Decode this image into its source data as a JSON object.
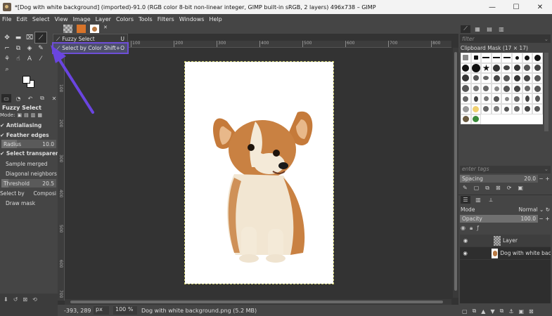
{
  "window": {
    "title": "*[Dog with white background] (imported)-91.0 (RGB color 8-bit non-linear integer, GIMP built-in sRGB, 2 layers) 496x738 – GIMP",
    "controls": [
      "—",
      "☐",
      "✕"
    ]
  },
  "menu": [
    "File",
    "Edit",
    "Select",
    "View",
    "Image",
    "Layer",
    "Colors",
    "Tools",
    "Filters",
    "Windows",
    "Help"
  ],
  "flyout": {
    "items": [
      {
        "label": "Fuzzy Select",
        "shortcut": "U"
      },
      {
        "label": "Select by Color",
        "shortcut": "Shift+O"
      }
    ]
  },
  "tool_options": {
    "title": "Fuzzy Select",
    "mode_label": "Mode:",
    "antialiasing": "Antialiasing",
    "feather": "Feather edges",
    "radius_label": "Radius",
    "radius_value": "10.0",
    "select_transparent": "Select transparent a",
    "sample_merged": "Sample merged",
    "diagonal": "Diagonal neighbors",
    "threshold_label": "Threshold",
    "threshold_value": "20.5",
    "select_by_label": "Select by",
    "select_by_value": "Composi",
    "draw_mask": "Draw mask"
  },
  "ruler": {
    "top_ticks": [
      "100",
      "200",
      "300",
      "400",
      "500",
      "600",
      "700",
      "800"
    ],
    "left_ticks": [
      "100",
      "200",
      "300",
      "400",
      "500",
      "600",
      "700"
    ]
  },
  "statusbar": {
    "coords": "-393, 289",
    "unit": "px",
    "zoom": "100 %",
    "message": "Dog with white background.png (5.2 MB)"
  },
  "right_dock": {
    "filter_placeholder": "filter",
    "brush_title": "Clipboard Mask (17 × 17)",
    "tags_placeholder": "enter tags",
    "spacing_label": "Spacing",
    "spacing_value": "20.0",
    "mode_label": "Mode",
    "mode_value": "Normal",
    "opacity_label": "Opacity",
    "opacity_value": "100.0",
    "layers": [
      {
        "name": "Layer"
      },
      {
        "name": "Dog with white back"
      }
    ]
  },
  "colors": {
    "selection_highlight": "#6e4ed8",
    "annotation_arrow": "#6a45e0",
    "canvas_bg": "#333333"
  }
}
